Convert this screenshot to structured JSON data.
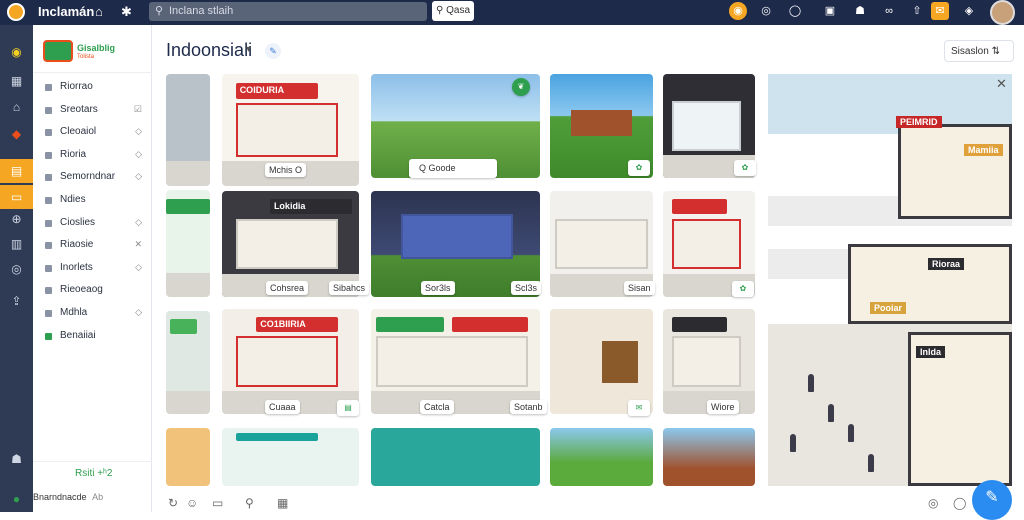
{
  "app": {
    "title": "Inclamán"
  },
  "search": {
    "placeholder": "Inclana stlaih",
    "button_label": "Qasa"
  },
  "sidebar": {
    "brand_name": "Gisalblig",
    "brand_sub": "Tolista",
    "items": [
      {
        "label": "Riorrao",
        "action": ""
      },
      {
        "label": "Sreotars",
        "action": "☑"
      },
      {
        "label": "Cleoaiol",
        "action": "◇"
      },
      {
        "label": "Rioria",
        "action": "◇"
      },
      {
        "label": "Semorndnar",
        "action": "◇"
      },
      {
        "label": "Ndies",
        "action": ""
      },
      {
        "label": "Cioslies",
        "action": "◇"
      },
      {
        "label": "Riaosie",
        "action": "✕"
      },
      {
        "label": "Inorlets",
        "action": "◇"
      },
      {
        "label": "Rieoeaog",
        "action": ""
      },
      {
        "label": "Mdhla",
        "action": "◇"
      },
      {
        "label": "Benaiiai",
        "action": ""
      }
    ],
    "footer_link": "Rsiti +ʰ2",
    "user_name": "Bnarndnacde",
    "user_meta": "Ab"
  },
  "main": {
    "title": "Indoonsiali",
    "sort_label": "Sisaslon ⇅",
    "captions": {
      "c1": "Mchis  O",
      "c2": "Q Goode",
      "c3": "Sor3ls",
      "c4": "Scl3s",
      "c5": "Cohsrea",
      "c6": "Sibahcs",
      "c7": "Cuaaa",
      "c8": "Catcla",
      "c9": "Sotanb",
      "c10": "Sisan",
      "c11": "Wiore"
    },
    "store_signs": {
      "s1": "COIDURIA",
      "s2": "Lokidia",
      "s3": "CO1BIIRIA",
      "s4": "Inldia"
    }
  },
  "preview": {
    "signs": [
      "PEIMRID",
      "Mamiia",
      "Rioraa",
      "Pooiar",
      "Inlda"
    ]
  },
  "colors": {
    "topbar": "#1e2a4a",
    "rail": "#2f3b55",
    "accent_orange": "#f5a623",
    "brand_green": "#2e9e4f",
    "fab_blue": "#2a8cf0"
  }
}
